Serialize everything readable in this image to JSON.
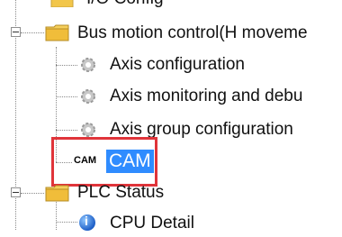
{
  "tree": {
    "top_partial_label": "I/O Config",
    "bus_motion": {
      "label": "Bus motion control(H moveme"
    },
    "axis_config": {
      "label": "Axis configuration"
    },
    "axis_monitor": {
      "label": "Axis monitoring and debu"
    },
    "axis_group": {
      "label": "Axis group configuration"
    },
    "cam": {
      "icon_text": "CAM",
      "label": "CAM"
    },
    "plc_status": {
      "label": "PLC Status"
    },
    "cpu_detail": {
      "label": "CPU Detail"
    }
  },
  "colors": {
    "selection_bg": "#2f8cff",
    "highlight_border": "#e0343a",
    "folder_yellow": "#f2c64a"
  },
  "icons": {
    "folder": "folder-icon",
    "gear": "gear-icon",
    "expander": "collapse-icon",
    "info": "info-icon"
  }
}
